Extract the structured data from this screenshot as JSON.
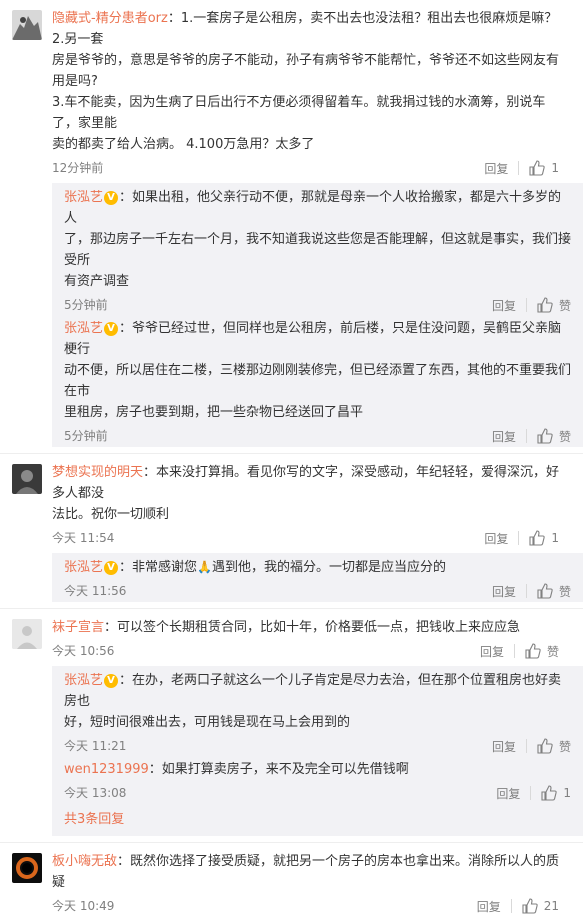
{
  "actions": {
    "reply": "回复",
    "like": "赞"
  },
  "comments": [
    {
      "user": "隐藏式-精分患者orz",
      "lines": [
        "：1.一套房子是公租房，卖不出去也没法租？租出去也很麻烦是嘛？ 2.另一套",
        "房是爷爷的，意思是爷爷的房子不能动，孙子有病爷爷不能帮忙，爷爷还不如这些网友有用是吗?",
        "3.车不能卖，因为生病了日后出行不方便必须得留着车。就我捐过钱的水滴筹，别说车了，家里能",
        "卖的都卖了给人治病。 4.100万急用？太多了"
      ],
      "time": "12分钟前",
      "likes": "1",
      "replies": [
        {
          "user": "张泓艺",
          "lines": [
            "：如果出租，他父亲行动不便，那就是母亲一个人收拾搬家，都是六十多岁的人",
            "了，那边房子一千左右一个月，我不知道我说这些您是否能理解，但这就是事实，我们接受所",
            "有资产调查"
          ],
          "time": "5分钟前",
          "likes": "赞"
        },
        {
          "user": "张泓艺",
          "lines": [
            "：爷爷已经过世，但同样也是公租房，前后楼，只是住没问题，吴鹤臣父亲脑梗行",
            "动不便，所以居住在二楼，三楼那边刚刚装修完，但已经添置了东西，其他的不重要我们在市",
            "里租房，房子也要到期，把一些杂物已经送回了昌平"
          ],
          "time": "5分钟前",
          "likes": "赞"
        }
      ]
    },
    {
      "user": "梦想实现的明天",
      "lines": [
        "：本来没打算捐。看见你写的文字，深受感动，年纪轻轻，爱得深沉，好多人都没",
        "法比。祝你一切顺利"
      ],
      "time": "今天 11:54",
      "likes": "1",
      "replies": [
        {
          "user": "张泓艺",
          "lines": [
            "：非常感谢您",
            "遇到他，我的福分。一切都是应当应分的"
          ],
          "time": "今天 11:56",
          "likes": "赞"
        }
      ]
    },
    {
      "user": "袜子宣言",
      "lines": [
        "：可以签个长期租赁合同，比如十年，价格要低一点，把钱收上来应应急"
      ],
      "time": "今天 10:56",
      "likes": "赞",
      "replies": [
        {
          "user": "张泓艺",
          "lines": [
            "：在办，老两口子就这么一个儿子肯定是尽力去治，但在那个位置租房也好卖房也",
            "好，短时间很难出去，可用钱是现在马上会用到的"
          ],
          "time": "今天 11:21",
          "likes": "赞"
        },
        {
          "user": "wen1231999",
          "lines": [
            "：如果打算卖房子，来不及完全可以先借钱啊"
          ],
          "time": "今天 13:08",
          "likes": "1"
        }
      ],
      "more": "共3条回复"
    },
    {
      "user": "板小嗨无敌",
      "lines": [
        "：既然你选择了接受质疑，就把另一个房子的房本也拿出来。消除所以人的质疑"
      ],
      "time": "今天 10:49",
      "likes": "21"
    }
  ]
}
